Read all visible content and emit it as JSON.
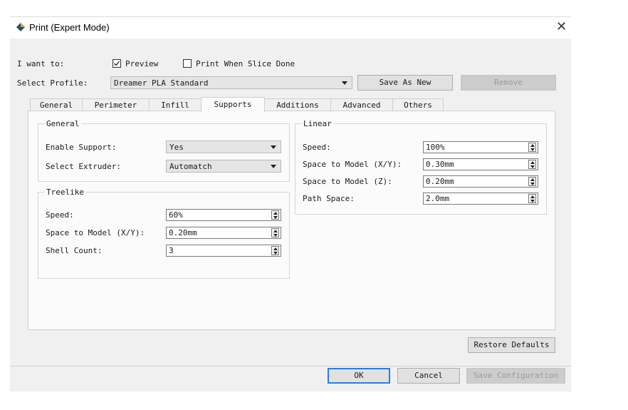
{
  "window": {
    "title": "Print (Expert Mode)"
  },
  "top": {
    "want_label": "I want to:",
    "preview_label": "Preview",
    "preview_checked": true,
    "print_when_done_label": "Print When Slice Done",
    "print_when_done_checked": false,
    "profile_label": "Select Profile:",
    "profile_value": "Dreamer PLA Standard",
    "save_as_new": "Save As New",
    "remove": "Remove"
  },
  "tabs": [
    "General",
    "Perimeter",
    "Infill",
    "Supports",
    "Additions",
    "Advanced",
    "Others"
  ],
  "active_tab": "Supports",
  "general": {
    "title": "General",
    "enable_support_label": "Enable Support:",
    "enable_support_value": "Yes",
    "select_extruder_label": "Select Extruder:",
    "select_extruder_value": "Automatch"
  },
  "treelike": {
    "title": "Treelike",
    "speed_label": "Speed:",
    "speed_value": "60%",
    "space_xy_label": "Space to Model (X/Y):",
    "space_xy_value": "0.20mm",
    "shell_count_label": "Shell Count:",
    "shell_count_value": "3"
  },
  "linear": {
    "title": "Linear",
    "speed_label": "Speed:",
    "speed_value": "100%",
    "space_xy_label": "Space to Model (X/Y):",
    "space_xy_value": "0.30mm",
    "space_z_label": "Space to Model (Z):",
    "space_z_value": "0.20mm",
    "path_space_label": "Path Space:",
    "path_space_value": "2.0mm"
  },
  "buttons": {
    "restore_defaults": "Restore Defaults",
    "ok": "OK",
    "cancel": "Cancel",
    "save_configuration": "Save Configuration"
  }
}
